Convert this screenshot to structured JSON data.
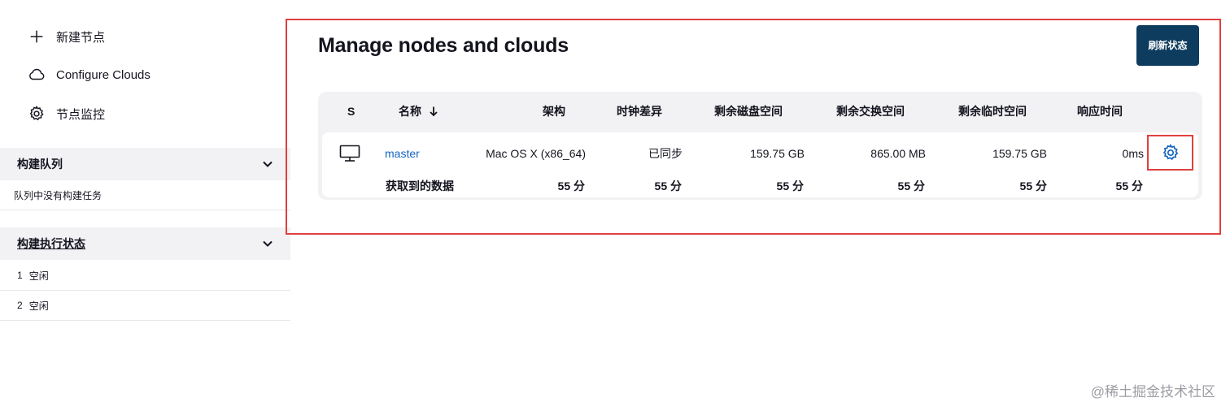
{
  "sidebar": {
    "tasks": {
      "new_node": "新建节点",
      "configure_clouds": "Configure Clouds",
      "node_monitoring": "节点监控"
    },
    "build_queue": {
      "title": "构建队列",
      "empty_message": "队列中没有构建任务"
    },
    "executor_status": {
      "title": "构建执行状态",
      "executors": [
        {
          "number": "1",
          "status": "空闲"
        },
        {
          "number": "2",
          "status": "空闲"
        }
      ]
    }
  },
  "main": {
    "title": "Manage nodes and clouds",
    "refresh_button": "刷新状态",
    "table": {
      "headers": {
        "status": "S",
        "name": "名称",
        "arch": "架构",
        "clock_diff": "时钟差异",
        "disk_space": "剩余磁盘空间",
        "swap_space": "剩余交换空间",
        "temp_space": "剩余临时空间",
        "response_time": "响应时间"
      },
      "row": {
        "name": "master",
        "arch": "Mac OS X (x86_64)",
        "clock_diff": "已同步",
        "disk_space": "159.75 GB",
        "swap_space": "865.00 MB",
        "temp_space": "159.75 GB",
        "response_time": "0ms"
      },
      "footer": {
        "label": "获取到的数据",
        "arch": "55 分",
        "clock_diff": "55 分",
        "disk_space": "55 分",
        "swap_space": "55 分",
        "temp_space": "55 分",
        "response_time": "55 分"
      }
    }
  },
  "watermark": "@稀土掘金技术社区",
  "colors": {
    "accent_red": "#e0403e",
    "primary_button": "#0e3c5e",
    "link_blue": "#1566c0"
  }
}
